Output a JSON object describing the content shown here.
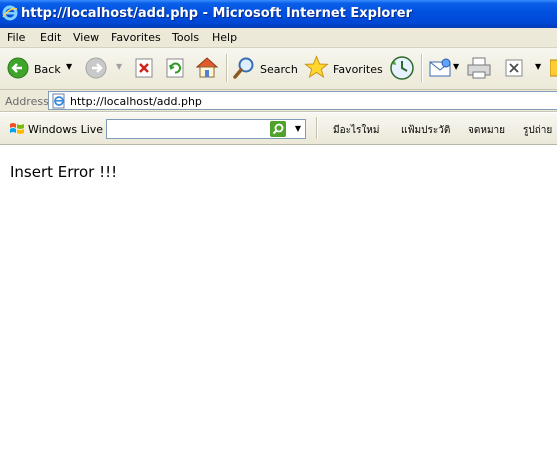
{
  "window": {
    "title": "http://localhost/add.php - Microsoft Internet Explorer"
  },
  "menu": {
    "items": [
      "File",
      "Edit",
      "View",
      "Favorites",
      "Tools",
      "Help"
    ]
  },
  "toolbar": {
    "back_label": "Back",
    "search_label": "Search",
    "favorites_label": "Favorites"
  },
  "address": {
    "label": "Address",
    "url": "http://localhost/add.php"
  },
  "live_toolbar": {
    "label": "Windows Live",
    "search_value": "",
    "links": [
      "มีอะไรใหม่",
      "แฟ้มประวัติ",
      "จดหมาย",
      "รูปถ่าย"
    ]
  },
  "content": {
    "message": "Insert Error !!!"
  },
  "colors": {
    "titlebar": "#0050e0",
    "chrome": "#ece9d8",
    "accent_green": "#4fa22b"
  }
}
